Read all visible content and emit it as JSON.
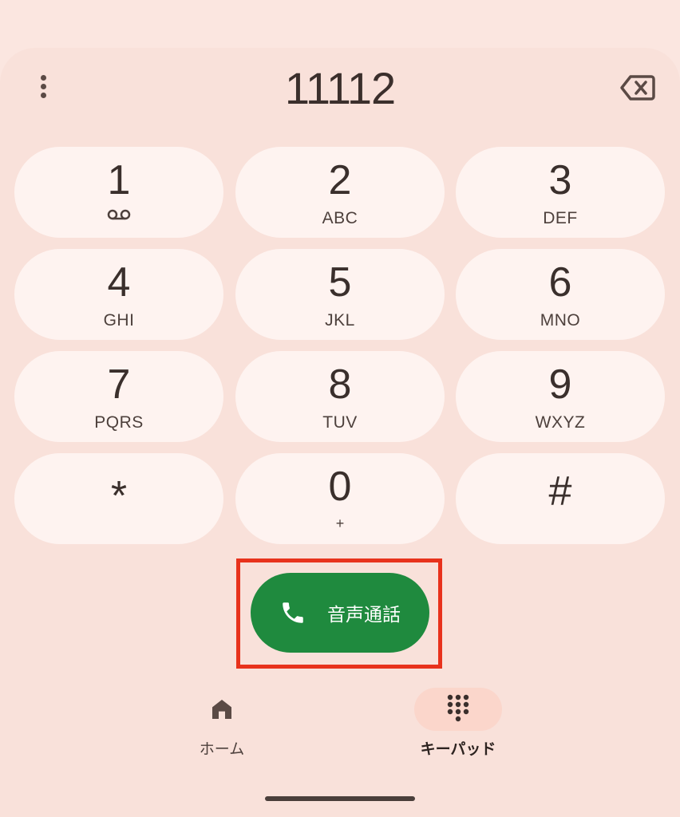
{
  "dialer": {
    "number": "11112"
  },
  "keys": [
    {
      "digit": "1",
      "letters": ""
    },
    {
      "digit": "2",
      "letters": "ABC"
    },
    {
      "digit": "3",
      "letters": "DEF"
    },
    {
      "digit": "4",
      "letters": "GHI"
    },
    {
      "digit": "5",
      "letters": "JKL"
    },
    {
      "digit": "6",
      "letters": "MNO"
    },
    {
      "digit": "7",
      "letters": "PQRS"
    },
    {
      "digit": "8",
      "letters": "TUV"
    },
    {
      "digit": "9",
      "letters": "WXYZ"
    },
    {
      "digit": "*",
      "letters": ""
    },
    {
      "digit": "0",
      "letters": "+"
    },
    {
      "digit": "#",
      "letters": ""
    }
  ],
  "call_button": {
    "label": "音声通話",
    "icon": "phone-icon",
    "color": "#1f8a3e"
  },
  "bottom_nav": {
    "home_label": "ホーム",
    "keypad_label": "キーパッド"
  },
  "colors": {
    "background": "#f9e1da",
    "key_fill": "#fef3f0",
    "highlight_box": "#e8321c"
  }
}
